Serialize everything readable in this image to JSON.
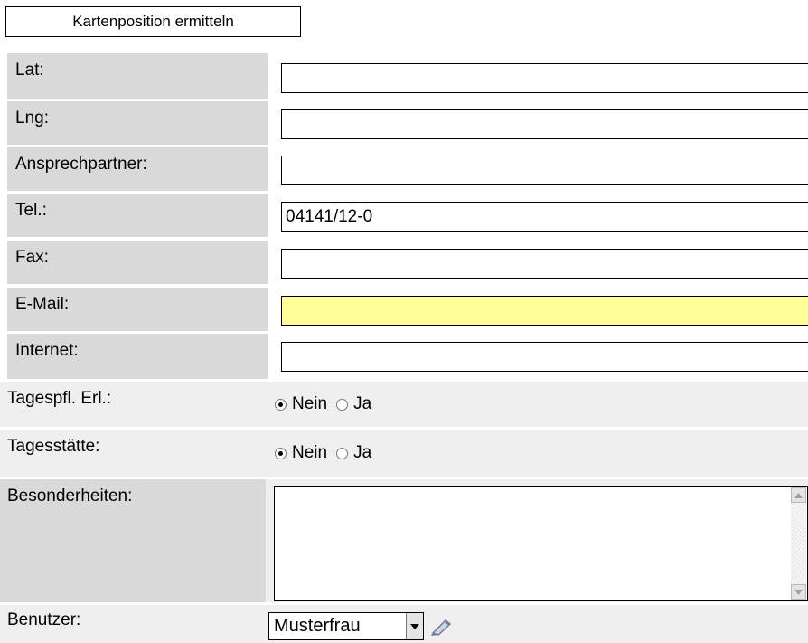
{
  "header": {
    "locate_button": "Kartenposition ermitteln"
  },
  "fields": {
    "lat": {
      "label": "Lat:",
      "value": ""
    },
    "lng": {
      "label": "Lng:",
      "value": ""
    },
    "contact": {
      "label": "Ansprechpartner:",
      "value": ""
    },
    "tel": {
      "label": "Tel.:",
      "value": "04141/12-0"
    },
    "fax": {
      "label": "Fax:",
      "value": ""
    },
    "email": {
      "label": "E-Mail:",
      "value": "",
      "highlight_color": "#ffff99"
    },
    "internet": {
      "label": "Internet:",
      "value": ""
    }
  },
  "radios": {
    "tagespfl": {
      "label": "Tagespfl. Erl.:",
      "options": [
        "Nein",
        "Ja"
      ],
      "selected": "Nein"
    },
    "tagesstaette": {
      "label": "Tagesstätte:",
      "options": [
        "Nein",
        "Ja"
      ],
      "selected": "Nein"
    }
  },
  "notes": {
    "label": "Besonderheiten:",
    "value": ""
  },
  "user": {
    "label": "Benutzer:",
    "selected": "Musterfrau",
    "edit_icon": "pencil-icon"
  },
  "colors": {
    "label_bg": "#d9d9d9",
    "row_bg": "#efefef",
    "email_bg": "#ffff99"
  }
}
